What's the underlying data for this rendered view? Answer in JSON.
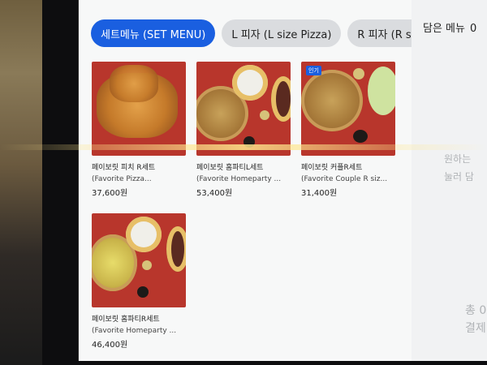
{
  "tabs": [
    {
      "label": "세트메뉴 (SET MENU)"
    },
    {
      "label": "L 피자 (L size Pizza)"
    },
    {
      "label": "R 피자 (R size P"
    }
  ],
  "cart": {
    "title": "담은 메뉴",
    "count": "0",
    "empty_line1": "원하는",
    "empty_line2": "눌러 담",
    "total_line1": "총 0",
    "total_line2": "결제"
  },
  "menu_items": [
    {
      "name": "페이보릿 피치 R세트",
      "subtitle": "(Favorite Pizza...",
      "price": "37,600원",
      "badge": ""
    },
    {
      "name": "페이보릿 홈파티L세트",
      "subtitle": "(Favorite Homeparty ...",
      "price": "53,400원",
      "badge": ""
    },
    {
      "name": "페이보릿 커플R세트",
      "subtitle": "(Favorite Couple R siz...",
      "price": "31,400원",
      "badge": "인기"
    },
    {
      "name": "페이보릿 홈파티R세트",
      "subtitle": "(Favorite Homeparty ...",
      "price": "46,400원",
      "badge": ""
    }
  ],
  "colors": {
    "accent": "#1a5fe0",
    "tab_inactive": "#dadcdf",
    "image_bg": "#b8362c"
  }
}
